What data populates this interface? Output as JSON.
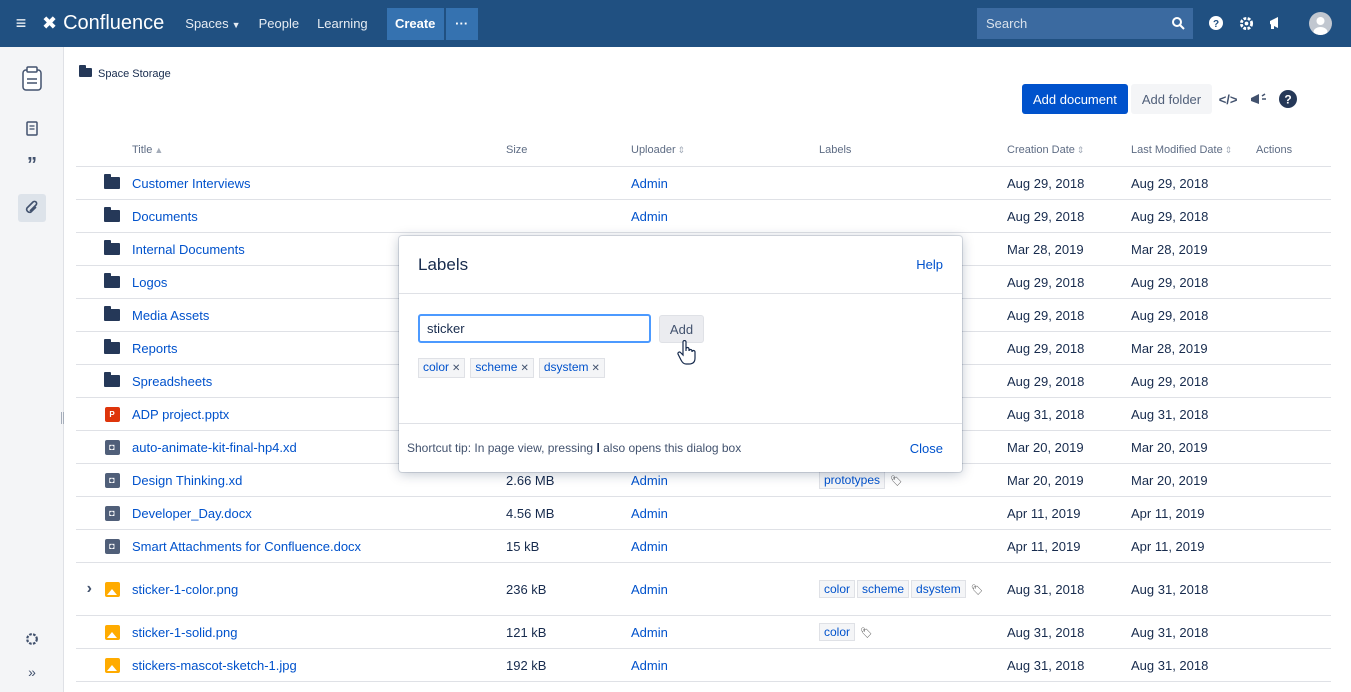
{
  "topbar": {
    "app_name": "Confluence",
    "nav": [
      "Spaces",
      "People",
      "Learning"
    ],
    "create_label": "Create",
    "more_label": "···",
    "search_placeholder": "Search"
  },
  "breadcrumb": {
    "label": "Space Storage"
  },
  "toolbar": {
    "add_document": "Add document",
    "add_folder": "Add folder"
  },
  "table": {
    "headers": {
      "title": "Title",
      "size": "Size",
      "uploader": "Uploader",
      "labels": "Labels",
      "creation": "Creation Date",
      "modified": "Last Modified Date",
      "actions": "Actions"
    },
    "rows": [
      {
        "type": "folder",
        "title": "Customer Interviews",
        "size": "",
        "uploader": "Admin",
        "labels": [],
        "created": "Aug 29, 2018",
        "modified": "Aug 29, 2018"
      },
      {
        "type": "folder",
        "title": "Documents",
        "size": "",
        "uploader": "Admin",
        "labels": [],
        "created": "Aug 29, 2018",
        "modified": "Aug 29, 2018"
      },
      {
        "type": "folder",
        "title": "Internal Documents",
        "size": "",
        "uploader": "",
        "labels": [],
        "created": "Mar 28, 2019",
        "modified": "Mar 28, 2019"
      },
      {
        "type": "folder",
        "title": "Logos",
        "size": "",
        "uploader": "",
        "labels": [],
        "created": "Aug 29, 2018",
        "modified": "Aug 29, 2018"
      },
      {
        "type": "folder",
        "title": "Media Assets",
        "size": "",
        "uploader": "",
        "labels": [],
        "created": "Aug 29, 2018",
        "modified": "Aug 29, 2018"
      },
      {
        "type": "folder",
        "title": "Reports",
        "size": "",
        "uploader": "",
        "labels": [],
        "created": "Aug 29, 2018",
        "modified": "Mar 28, 2019"
      },
      {
        "type": "folder",
        "title": "Spreadsheets",
        "size": "",
        "uploader": "",
        "labels": [],
        "created": "Aug 29, 2018",
        "modified": "Aug 29, 2018"
      },
      {
        "type": "ppt",
        "title": "ADP project.pptx",
        "size": "",
        "uploader": "",
        "labels": [],
        "created": "Aug 31, 2018",
        "modified": "Aug 31, 2018"
      },
      {
        "type": "doc",
        "title": "auto-animate-kit-final-hp4.xd",
        "size": "",
        "uploader": "",
        "labels": [],
        "created": "Mar 20, 2019",
        "modified": "Mar 20, 2019"
      },
      {
        "type": "doc",
        "title": "Design Thinking.xd",
        "size": "2.66 MB",
        "uploader": "Admin",
        "labels": [
          "prototypes"
        ],
        "created": "Mar 20, 2019",
        "modified": "Mar 20, 2019"
      },
      {
        "type": "doc",
        "title": "Developer_Day.docx",
        "size": "4.56 MB",
        "uploader": "Admin",
        "labels": [],
        "created": "Apr 11, 2019",
        "modified": "Apr 11, 2019"
      },
      {
        "type": "doc",
        "title": "Smart Attachments for Confluence.docx",
        "size": "15 kB",
        "uploader": "Admin",
        "labels": [],
        "created": "Apr 11, 2019",
        "modified": "Apr 11, 2019"
      },
      {
        "type": "img",
        "expand": true,
        "title": "sticker-1-color.png",
        "size": "236 kB",
        "uploader": "Admin",
        "labels": [
          "color",
          "scheme",
          "dsystem"
        ],
        "created": "Aug 31, 2018",
        "modified": "Aug 31, 2018"
      },
      {
        "type": "img",
        "title": "sticker-1-solid.png",
        "size": "121 kB",
        "uploader": "Admin",
        "labels": [
          "color"
        ],
        "created": "Aug 31, 2018",
        "modified": "Aug 31, 2018"
      },
      {
        "type": "img",
        "title": "stickers-mascot-sketch-1.jpg",
        "size": "192 kB",
        "uploader": "Admin",
        "labels": [],
        "created": "Aug 31, 2018",
        "modified": "Aug 31, 2018"
      }
    ]
  },
  "modal": {
    "title": "Labels",
    "help": "Help",
    "input_value": "sticker",
    "add_label": "Add",
    "chips": [
      "color",
      "scheme",
      "dsystem"
    ],
    "tip_prefix": "Shortcut tip: In page view, pressing ",
    "tip_key": "l",
    "tip_suffix": " also opens this dialog box",
    "close": "Close"
  }
}
